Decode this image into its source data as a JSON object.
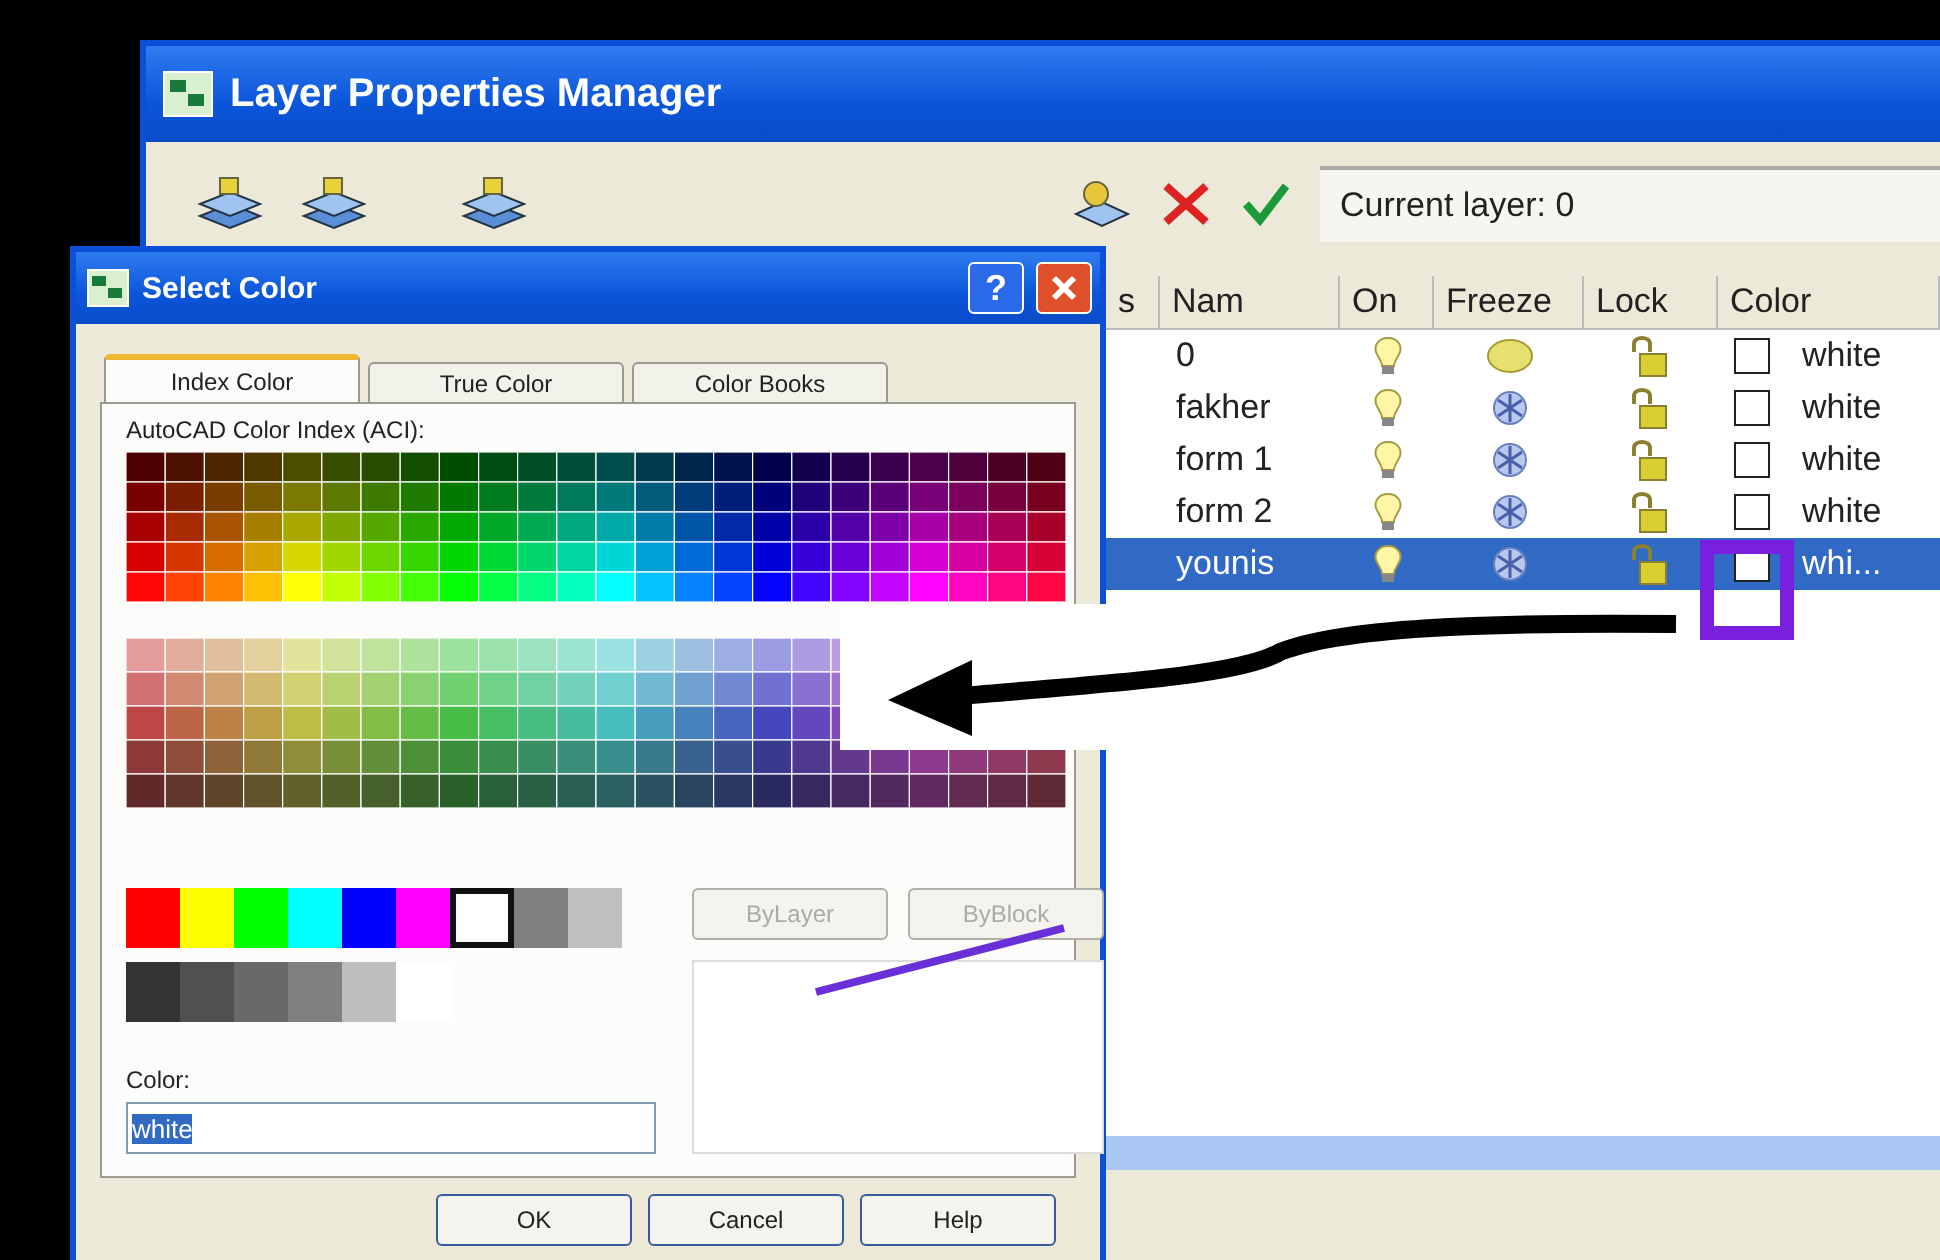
{
  "layer_window": {
    "title": "Layer Properties Manager",
    "current_layer": "Current layer: 0",
    "columns": [
      "s",
      "Nam",
      "On",
      "Freeze",
      "Lock",
      "Color"
    ],
    "rows": [
      {
        "name": "0",
        "on": true,
        "frozen": false,
        "locked": false,
        "color_name": "white",
        "selected": false
      },
      {
        "name": "fakher",
        "on": true,
        "frozen": true,
        "locked": false,
        "color_name": "white",
        "selected": false
      },
      {
        "name": "form 1",
        "on": true,
        "frozen": true,
        "locked": false,
        "color_name": "white",
        "selected": false
      },
      {
        "name": "form 2",
        "on": true,
        "frozen": true,
        "locked": false,
        "color_name": "white",
        "selected": false
      },
      {
        "name": "younis",
        "on": true,
        "frozen": true,
        "locked": false,
        "color_name": "whi...",
        "selected": true
      }
    ]
  },
  "select_color": {
    "title": "Select Color",
    "help_glyph": "?",
    "tabs": [
      {
        "label": "Index Color",
        "selected": true
      },
      {
        "label": "True Color",
        "selected": false
      },
      {
        "label": "Color Books",
        "selected": false
      }
    ],
    "palette_label": "AutoCAD Color Index (ACI):",
    "standard_colors": [
      {
        "color": "#ff0000",
        "selected": false
      },
      {
        "color": "#ffff00",
        "selected": false
      },
      {
        "color": "#00ff00",
        "selected": false
      },
      {
        "color": "#00ffff",
        "selected": false
      },
      {
        "color": "#0000ff",
        "selected": false
      },
      {
        "color": "#ff00ff",
        "selected": false
      },
      {
        "color": "#ffffff",
        "selected": true
      },
      {
        "color": "#808080",
        "selected": false
      },
      {
        "color": "#c0c0c0",
        "selected": false
      }
    ],
    "gray_colors": [
      {
        "color": "#333333",
        "selected": false
      },
      {
        "color": "#505050",
        "selected": false
      },
      {
        "color": "#696969",
        "selected": false
      },
      {
        "color": "#808080",
        "selected": false
      },
      {
        "color": "#bebebe",
        "selected": false
      },
      {
        "color": "#ffffff",
        "selected": false
      }
    ],
    "bylayer_button": {
      "label": "ByLayer",
      "disabled": true
    },
    "byblock_button": {
      "label": "ByBlock",
      "disabled": true
    },
    "color_label": "Color:",
    "color_value": "white",
    "buttons": [
      "OK",
      "Cancel",
      "Help"
    ]
  }
}
